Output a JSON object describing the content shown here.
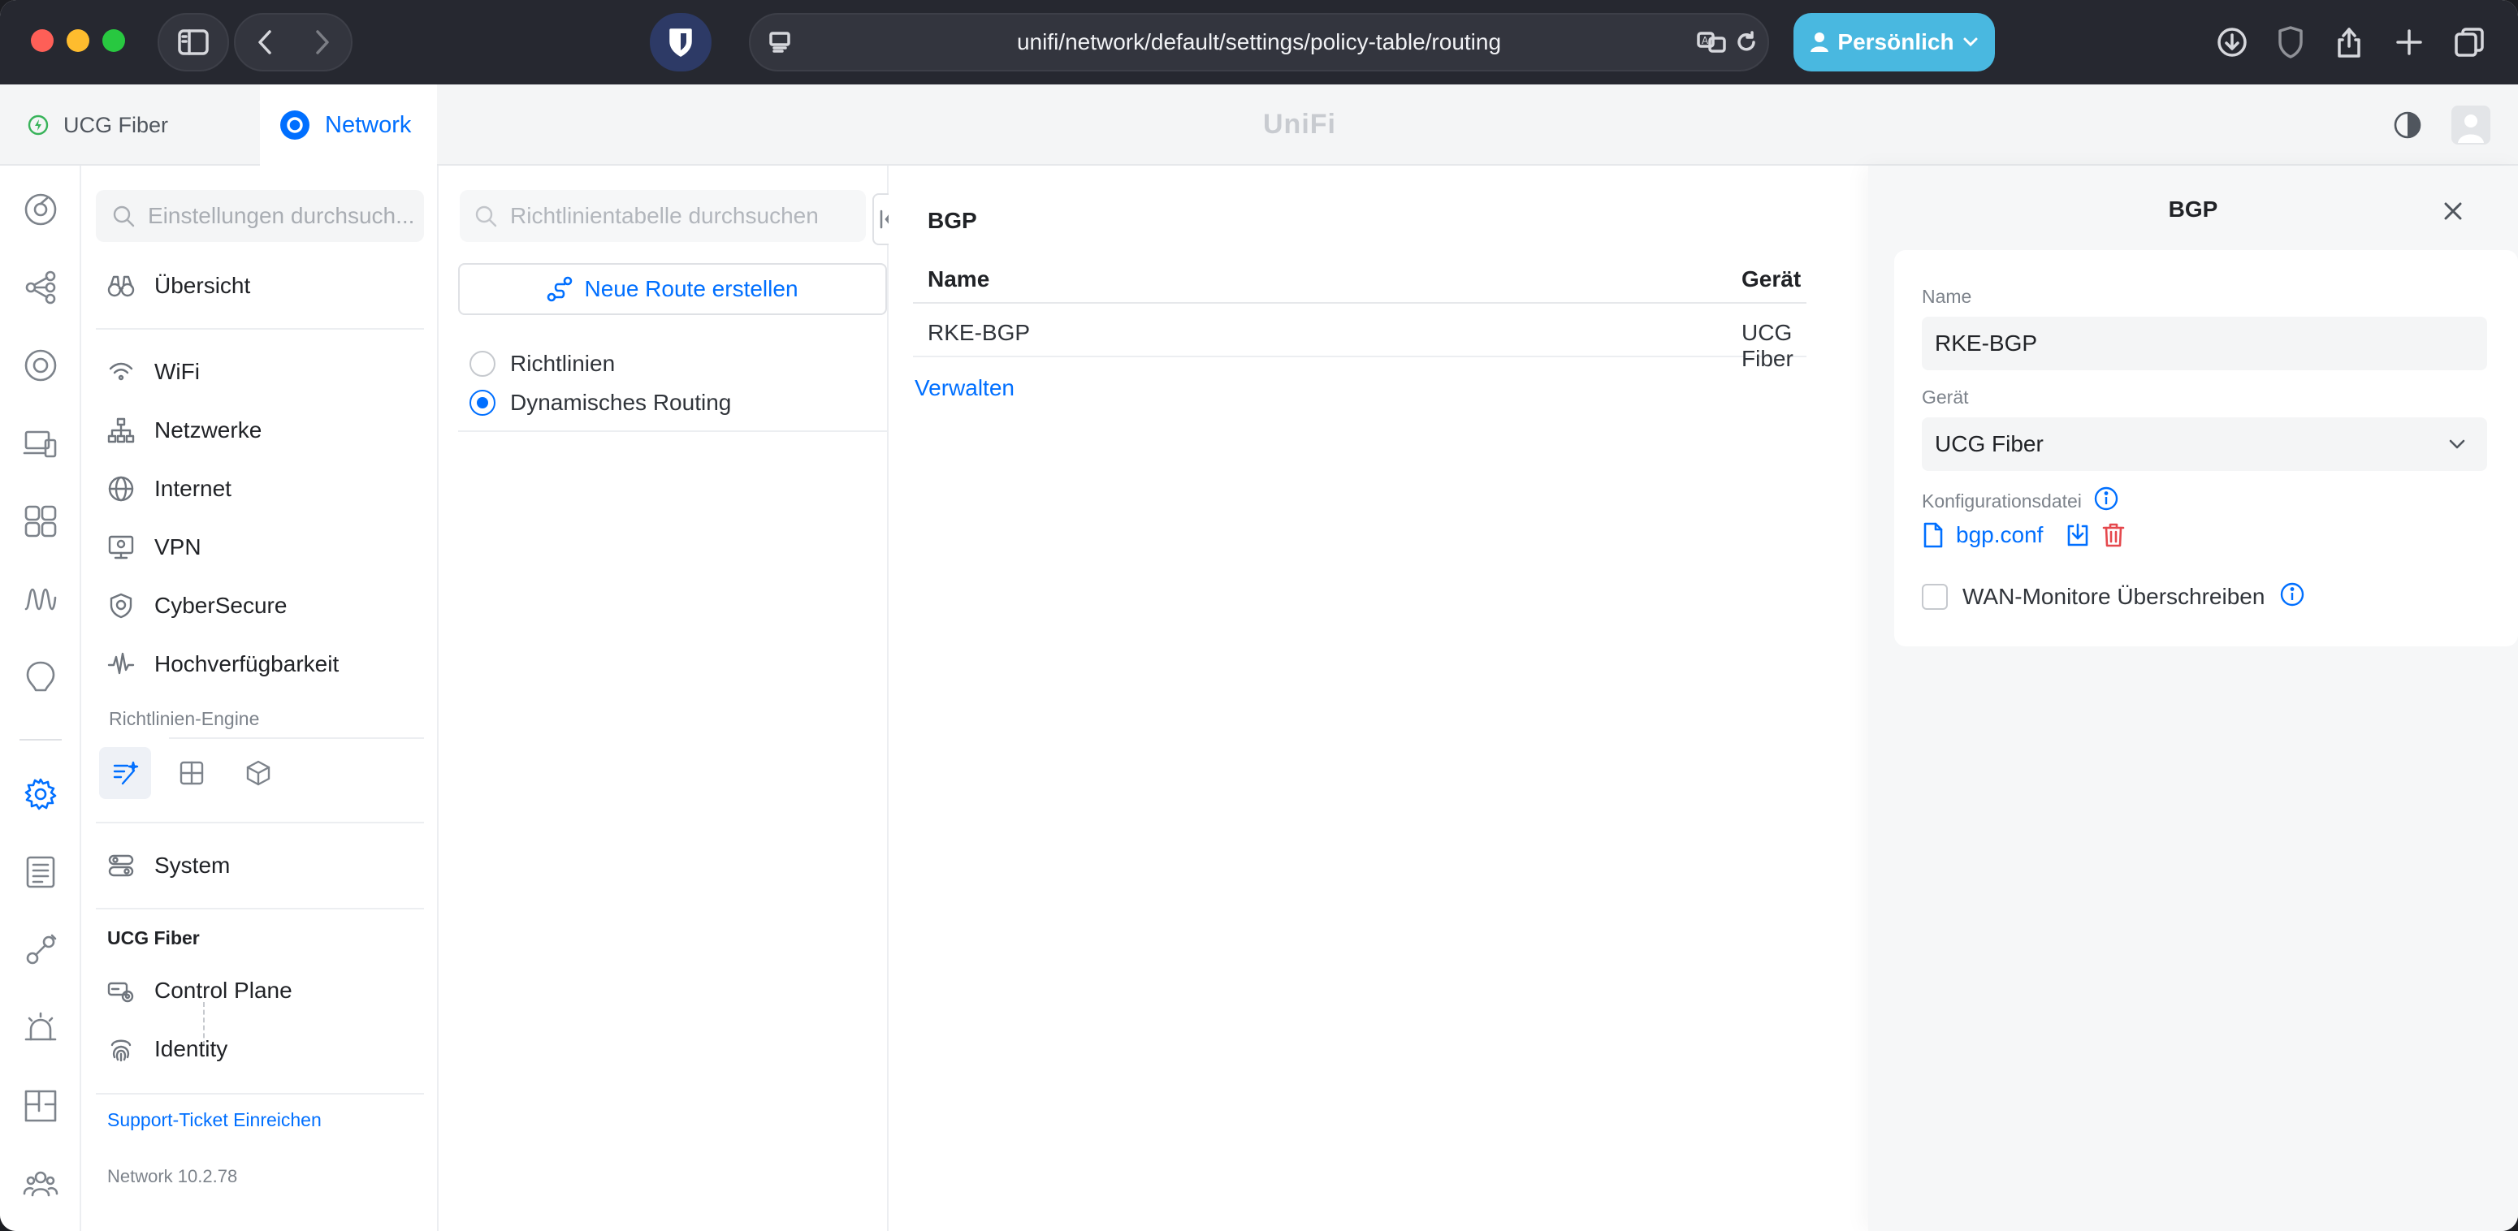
{
  "browser": {
    "url": "unifi/network/default/settings/policy-table/routing",
    "profile_button": "Persönlich"
  },
  "appbar": {
    "device_tab": "UCG Fiber",
    "network_tab": "Network",
    "logo": "UniFi"
  },
  "sidebar": {
    "search_placeholder": "Einstellungen durchsuch...",
    "items": [
      {
        "label": "Übersicht",
        "icon": "binoculars-icon"
      },
      {
        "label": "WiFi",
        "icon": "wifi-icon"
      },
      {
        "label": "Netzwerke",
        "icon": "network-tree-icon"
      },
      {
        "label": "Internet",
        "icon": "globe-icon"
      },
      {
        "label": "VPN",
        "icon": "vpn-icon"
      },
      {
        "label": "CyberSecure",
        "icon": "shield-icon"
      },
      {
        "label": "Hochverfügbarkeit",
        "icon": "pulse-icon"
      }
    ],
    "engine_section": "Richtlinien-Engine",
    "system_label": "System",
    "device_title": "UCG Fiber",
    "device_items": [
      {
        "label": "Control Plane",
        "icon": "control-plane-icon"
      },
      {
        "label": "Identity",
        "icon": "fingerprint-icon"
      }
    ],
    "support_link": "Support-Ticket Einreichen",
    "version": "Network 10.2.78"
  },
  "policy": {
    "search_placeholder": "Richtlinientabelle durchsuchen",
    "new_route_button": "Neue Route erstellen",
    "options": [
      {
        "label": "Richtlinien",
        "checked": false
      },
      {
        "label": "Dynamisches Routing",
        "checked": true
      }
    ]
  },
  "main": {
    "section_title": "BGP",
    "columns": [
      "Name",
      "Gerät"
    ],
    "rows": [
      {
        "name": "RKE-BGP",
        "device": "UCG Fiber"
      }
    ],
    "manage_link": "Verwalten"
  },
  "panel": {
    "title": "BGP",
    "name_label": "Name",
    "name_value": "RKE-BGP",
    "device_label": "Gerät",
    "device_value": "UCG Fiber",
    "config_label": "Konfigurationsdatei",
    "config_file": "bgp.conf",
    "wan_override_label": "WAN-Monitore Überschreiben",
    "wan_override_checked": false
  },
  "colors": {
    "accent": "#006fff",
    "profile_button": "#49b8e0",
    "delete": "#e5484d",
    "chrome_bg": "#262830"
  }
}
